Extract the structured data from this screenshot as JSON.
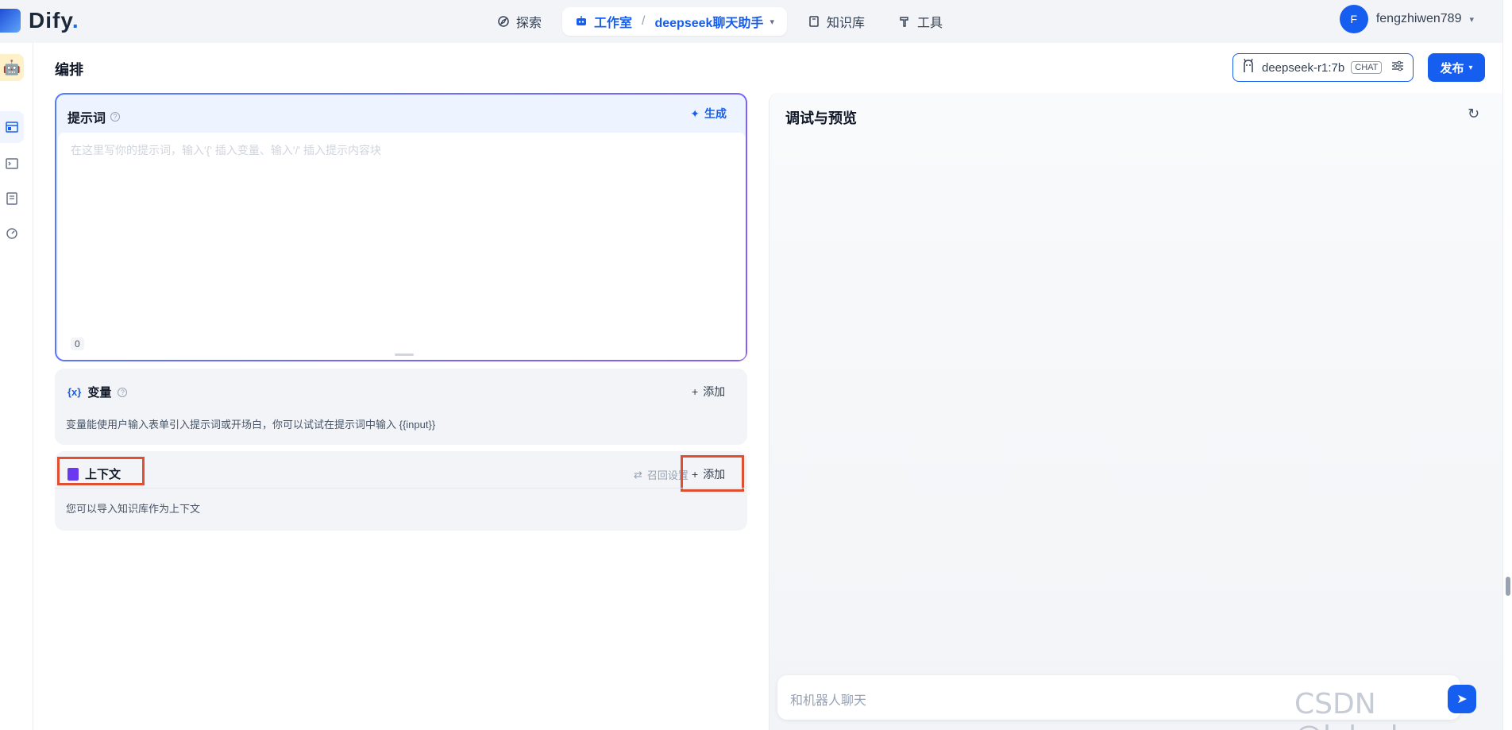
{
  "logo": {
    "text": "Dify",
    "dot": "."
  },
  "nav": {
    "explore": "探索",
    "studio": "工作室",
    "separator": "/",
    "app_name": "deepseek聊天助手",
    "knowledge": "知识库",
    "tools": "工具"
  },
  "user": {
    "initial": "F",
    "name": "fengzhiwen789"
  },
  "header": {
    "title": "编排",
    "model": "deepseek-r1:7b",
    "model_badge": "CHAT",
    "publish": "发布"
  },
  "prompt": {
    "title": "提示词",
    "generate": "生成",
    "placeholder": "在这里写你的提示词，输入'{' 插入变量、输入'/' 插入提示内容块",
    "count": "0"
  },
  "variables": {
    "title": "变量",
    "add": "添加",
    "description": "变量能使用户输入表单引入提示词或开场白，你可以试试在提示词中输入 {{input}}"
  },
  "context": {
    "title": "上下文",
    "recall": "召回设置",
    "add": "添加",
    "description": "您可以导入知识库作为上下文"
  },
  "debug": {
    "title": "调试与预览",
    "chat_placeholder": "和机器人聊天"
  },
  "watermark": "CSDN @leluckys",
  "colors": {
    "accent": "#155eef",
    "highlight": "#e04f2f",
    "context_icon": "#6938ef"
  }
}
